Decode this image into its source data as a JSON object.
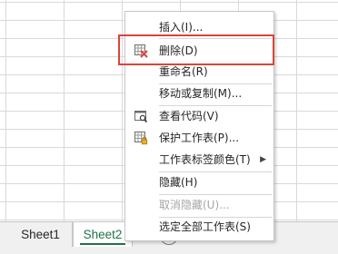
{
  "sheet_tabs": [
    {
      "label": "Sheet1",
      "active": false
    },
    {
      "label": "Sheet2",
      "active": true
    }
  ],
  "add_sheet_symbol": "+",
  "context_menu": {
    "items": [
      {
        "label": "插入(I)...",
        "icon": null
      },
      {
        "label": "删除(D)",
        "icon": "delete-sheet-icon",
        "highlighted": true
      },
      {
        "label": "重命名(R)",
        "icon": null
      },
      {
        "label": "移动或复制(M)...",
        "icon": null
      },
      {
        "label": "查看代码(V)",
        "icon": "view-code-icon"
      },
      {
        "label": "保护工作表(P)...",
        "icon": "protect-sheet-icon"
      },
      {
        "label": "工作表标签颜色(T)",
        "icon": null,
        "submenu_arrow": "▶"
      },
      {
        "label": "隐藏(H)",
        "icon": null
      },
      {
        "label": "取消隐藏(U)...",
        "icon": null,
        "disabled": true
      },
      {
        "label": "选定全部工作表(S)",
        "icon": null
      }
    ]
  },
  "colors": {
    "accent_green": "#217346",
    "highlight_red": "#d9453a",
    "disabled_text": "#a6a6a6"
  }
}
